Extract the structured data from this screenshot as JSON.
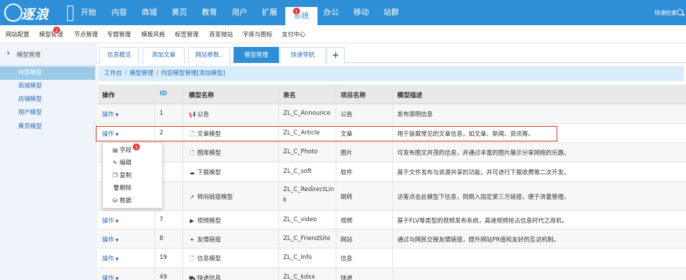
{
  "logo": {
    "text": "逐浪"
  },
  "topnav": {
    "items": [
      "开始",
      "内容",
      "商城",
      "黄页",
      "教育",
      "用户",
      "扩展",
      "系统",
      "办公",
      "移动",
      "站群"
    ],
    "active_badge": "1",
    "quick_search": "快速检索"
  },
  "subnav": {
    "items": [
      "网站配置",
      "模型管理",
      "节点管理",
      "专题管理",
      "模板风格",
      "标签管理",
      "百变微站",
      "字库与图标",
      "支付中心"
    ],
    "badge": "2"
  },
  "sidebar": {
    "group": "模型管理",
    "items": [
      "内容模型",
      "商城模型",
      "店铺模型",
      "用户模型",
      "黄页模型"
    ]
  },
  "tabs": [
    "信息概览",
    "添加文章",
    "网站参数..",
    "模型管理",
    "快速导航",
    "+"
  ],
  "breadcrumb": [
    "工作台",
    "模型管理",
    "内容模型管理[添加模型]"
  ],
  "table": {
    "headers": [
      "操作",
      "ID",
      "模型名称",
      "表名",
      "项目名称",
      "模型描述"
    ],
    "op_label": "操作",
    "rows": [
      {
        "id": "1",
        "icon": "bullhorn-icon",
        "glyph": "📢",
        "name": "公告",
        "table_line1": "ZL_C_Announce",
        "table_line2": "",
        "project": "公告",
        "desc": "发布简明信息"
      },
      {
        "id": "2",
        "icon": "file-icon",
        "glyph": "🗋",
        "name": "文章模型",
        "table_line1": "ZL_C_Article",
        "table_line2": "",
        "project": "文章",
        "desc": "用于装载常见的文章信息，如文章、新闻、资讯等。"
      },
      {
        "id": "",
        "icon": "file-image-icon",
        "glyph": "🗋",
        "name": "图库模型",
        "table_line1": "ZL_C_Photo",
        "table_line2": "",
        "project": "图片",
        "desc": "可发布图文并茂的信息，并通过丰富的图片展示分享网络的乐趣。"
      },
      {
        "id": "",
        "icon": "cloud-download-icon",
        "glyph": "☁",
        "name": "下载模型",
        "table_line1": "ZL_C_soft",
        "table_line2": "",
        "project": "软件",
        "desc": "基于文件发布与资源共享的功能，并可进行下载收费等二次开发。"
      },
      {
        "id": "",
        "icon": "share-icon",
        "glyph": "↗",
        "name": "转向链接模型",
        "table_line1": "ZL_C_RedirectLin",
        "table_line2": "k",
        "project": "跳转",
        "desc": "访客点击此模型下信息，则跳入指定第三方链接，便于流量管理。"
      },
      {
        "id": "7",
        "icon": "video-icon",
        "glyph": "▶",
        "name": "视频模型",
        "table_line1": "ZL_C_video",
        "table_line2": "",
        "project": "视频",
        "desc": "基于FLV等类型的视频发布系统，高速视频抢占信息时代之商机。"
      },
      {
        "id": "8",
        "icon": "link-icon",
        "glyph": "⚭",
        "name": "友情链接",
        "table_line1": "ZL_C_FriendSite",
        "table_line2": "",
        "project": "网站",
        "desc": "通过与网民交换友情链接，提升网站PR值和友好的互访机制。"
      },
      {
        "id": "19",
        "icon": "file-icon",
        "glyph": "🗋",
        "name": "信息模型",
        "table_line1": "ZL_C_Info",
        "table_line2": "",
        "project": "信息",
        "desc": ""
      },
      {
        "id": "49",
        "icon": "car-icon",
        "glyph": "⛟",
        "name": "快递信息",
        "table_line1": "ZL_C_kdxx",
        "table_line2": "",
        "project": "快递",
        "desc": ""
      }
    ]
  },
  "dropdown": {
    "badge": "3",
    "items": [
      "字段",
      "编辑",
      "复制",
      "删除",
      "数据"
    ]
  },
  "colors": {
    "primary": "#2e8fd6",
    "sidebar_active": "#9cc9e8",
    "breadcrumb_bg": "#d9ecfa",
    "highlight": "#d0342c",
    "badge": "#e63232"
  }
}
